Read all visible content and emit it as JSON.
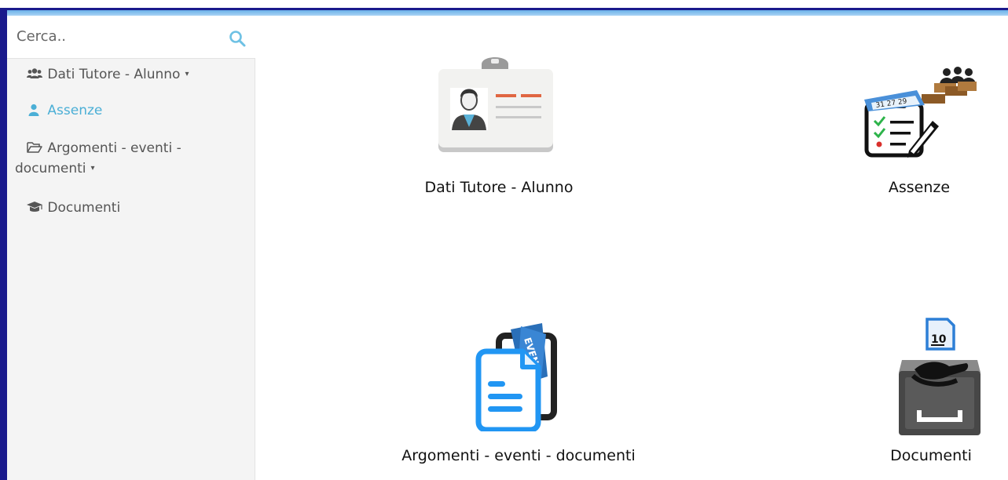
{
  "search": {
    "placeholder": "Cerca.."
  },
  "sidebar": {
    "items": [
      {
        "label": "Dati Tutore - Alunno",
        "icon": "users-icon",
        "has_caret": true
      },
      {
        "label": "Assenze",
        "icon": "user-icon",
        "active": true,
        "has_caret": false
      },
      {
        "label": "Argomenti - eventi -",
        "label_line2": "documenti",
        "icon": "folder-open-icon",
        "has_caret": true
      },
      {
        "label": "Documenti",
        "icon": "graduation-cap-icon",
        "has_caret": false
      }
    ],
    "caret": "▾"
  },
  "tiles": [
    {
      "label": "Dati Tutore - Alunno",
      "icon": "id-badge-icon"
    },
    {
      "label": "Assenze",
      "icon": "attendance-register-icon"
    },
    {
      "label": "Argomenti - eventi - documenti",
      "icon": "event-documents-icon"
    },
    {
      "label": "Documenti",
      "icon": "document-tray-icon"
    }
  ],
  "colors": {
    "accent": "#4bafd6",
    "frame": "#1a1a8c",
    "sidebar_bg": "#f4f4f4"
  }
}
